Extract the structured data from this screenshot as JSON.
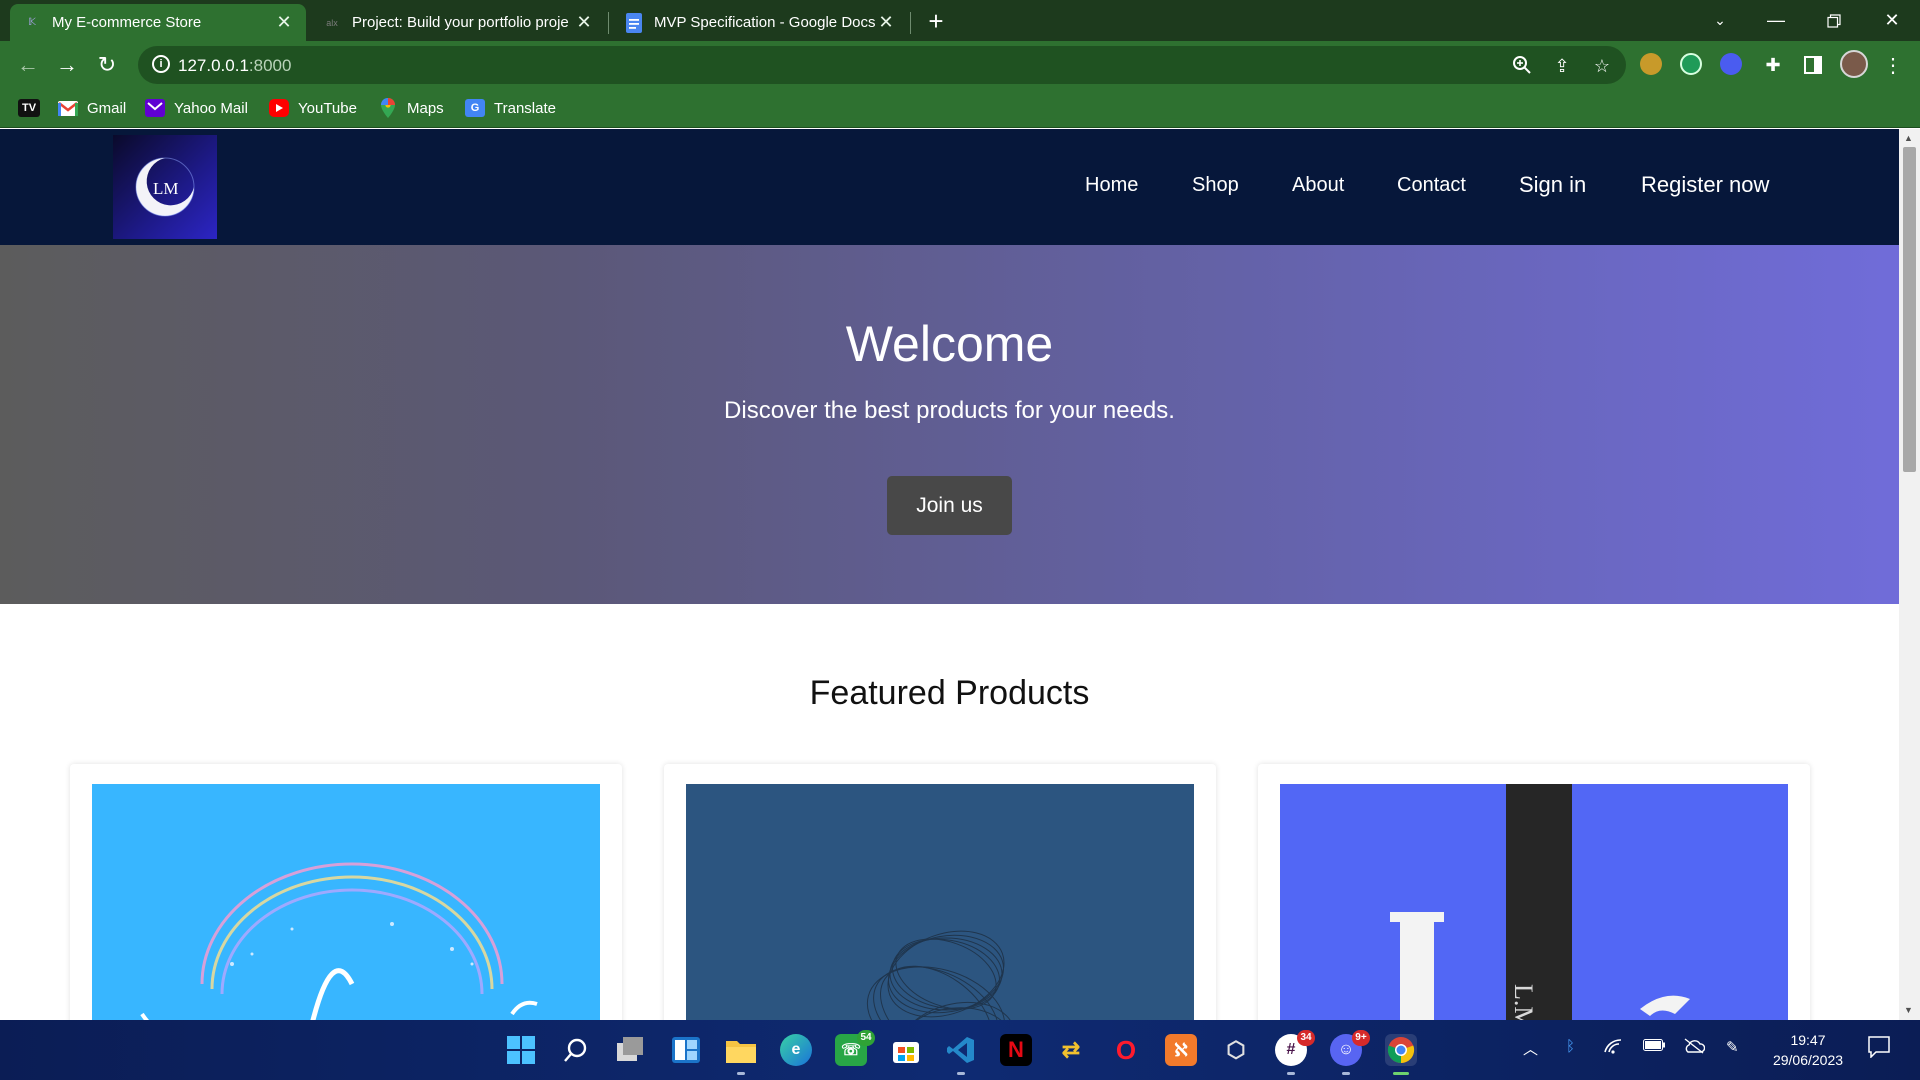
{
  "browser": {
    "tabs": [
      {
        "title": "My E-commerce Store",
        "active": true
      },
      {
        "title": "Project: Build your portfolio proje",
        "active": false
      },
      {
        "title": "MVP Specification - Google Docs",
        "active": false
      }
    ],
    "url_host": "127.0.0.1",
    "url_port": ":8000",
    "bookmarks": [
      {
        "label": "",
        "icon": "tv-icon"
      },
      {
        "label": "Gmail",
        "icon": "gmail-icon"
      },
      {
        "label": "Yahoo Mail",
        "icon": "yahoo-mail-icon"
      },
      {
        "label": "YouTube",
        "icon": "youtube-icon"
      },
      {
        "label": "Maps",
        "icon": "maps-icon"
      },
      {
        "label": "Translate",
        "icon": "translate-icon"
      }
    ]
  },
  "site": {
    "logo_text": "LM",
    "nav": {
      "home": "Home",
      "shop": "Shop",
      "about": "About",
      "contact": "Contact",
      "signin": "Sign in",
      "register": "Register now"
    },
    "hero": {
      "title": "Welcome",
      "subtitle": "Discover the best products for your needs.",
      "cta": "Join us"
    },
    "featured_title": "Featured Products",
    "products": [
      {
        "image": "product-image-1",
        "color": "#38b6ff"
      },
      {
        "image": "product-image-2",
        "color": "#2c5580"
      },
      {
        "image": "product-image-3",
        "color": "#5267f5",
        "caption": "L.M"
      }
    ]
  },
  "taskbar": {
    "badges": {
      "whatsapp": "54",
      "slack": "34",
      "discord": "9+"
    },
    "time": "19:47",
    "date": "29/06/2023"
  },
  "colors": {
    "nav_bg": "#06173a",
    "chrome_green": "#2e7130",
    "cta_bg": "#484848"
  }
}
